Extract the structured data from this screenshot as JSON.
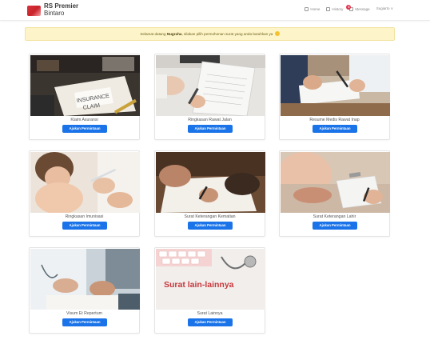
{
  "navbar": {
    "brand_line1": "RS Premier",
    "brand_line2": "Bintaro",
    "items": [
      {
        "label": "Home",
        "icon": "home-icon"
      },
      {
        "label": "History",
        "icon": "history-icon"
      },
      {
        "label": "Message",
        "icon": "message-icon",
        "badge": "6"
      },
      {
        "label": "Sugiarto ∨",
        "icon": ""
      }
    ]
  },
  "alert": {
    "text_before": "Selamat datang ",
    "name": "Nugraha",
    "text_after": ", silakan pilih permohonan surat yang anda butuhkan ya "
  },
  "colors": {
    "primary_button": "#1a73e8",
    "alert_bg": "#fdf5c9",
    "brand_red": "#d8323a"
  },
  "cards": [
    {
      "title": "Klaim Asuransi",
      "button": "Ajukan Permintaan",
      "image": "insurance-claim-photo"
    },
    {
      "title": "Ringkasan Rawat Jalan",
      "button": "Ajukan Permintaan",
      "image": "clipboard-form-photo"
    },
    {
      "title": "Resume Medis Rawat Inap",
      "button": "Ajukan Permintaan",
      "image": "doctor-consultation-photo"
    },
    {
      "title": "Ringkasan Imunisasi",
      "button": "Ajukan Permintaan",
      "image": "child-vaccination-photo"
    },
    {
      "title": "Surat Keterangan Kematian",
      "button": "Ajukan Permintaan",
      "image": "signing-document-photo"
    },
    {
      "title": "Surat Keterangan Lahir",
      "button": "Ajukan Permintaan",
      "image": "pregnancy-checkup-photo"
    },
    {
      "title": "Visum Et Repertum",
      "button": "Ajukan Permintaan",
      "image": "doctor-patient-photo"
    },
    {
      "title": "Surat Lainnya",
      "button": "Ajukan Permintaan",
      "image": "other-letters-photo",
      "image_text": "Surat lain-lainnya"
    }
  ]
}
